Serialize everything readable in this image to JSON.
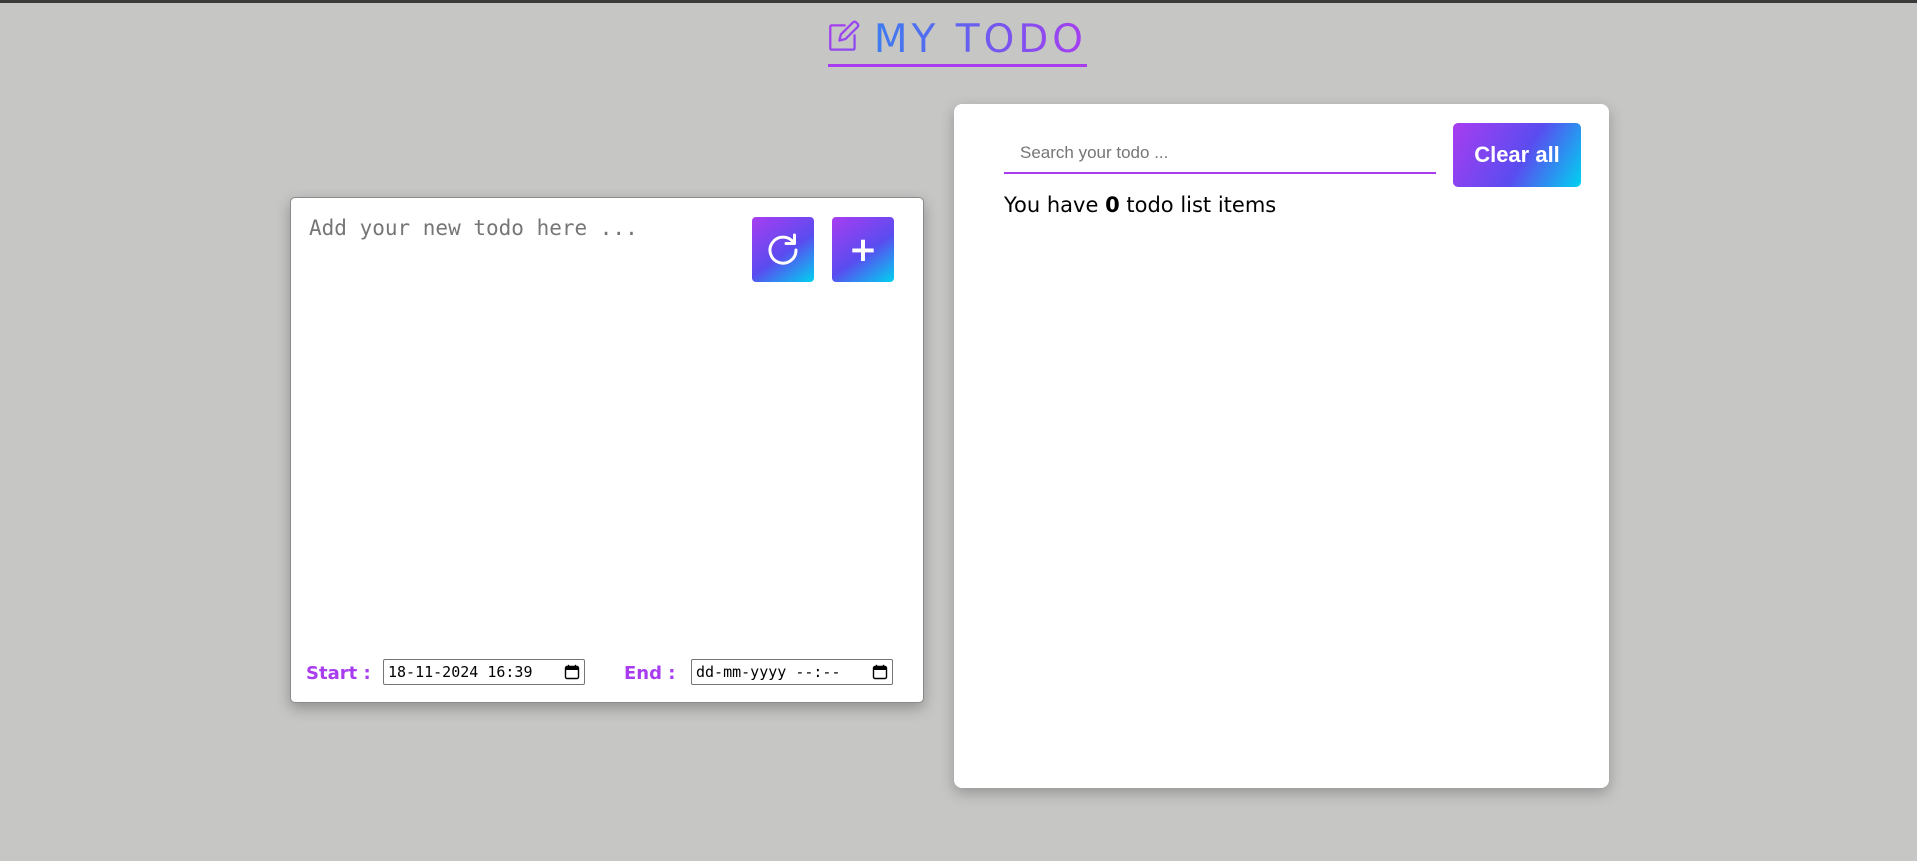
{
  "header": {
    "title": "MY TODO",
    "icon": "edit-icon",
    "accent_color": "#a83df0",
    "gradient": [
      "#3c7df0",
      "#a83df0"
    ]
  },
  "add_card": {
    "todo_placeholder": "Add your new todo here ...",
    "todo_value": "",
    "refresh_icon": "refresh-icon",
    "add_button_label": "+",
    "start_label": "Start :",
    "start_value": "18-11-2024 16:39",
    "end_label": "End :",
    "end_value": "dd-mm-yyyy --:--",
    "calendar_icon": "calendar-icon"
  },
  "list_card": {
    "search_placeholder": "Search your todo ...",
    "search_value": "",
    "clear_all_label": "Clear all",
    "count_prefix": "You have ",
    "count": "0",
    "count_suffix": " todo list items"
  }
}
